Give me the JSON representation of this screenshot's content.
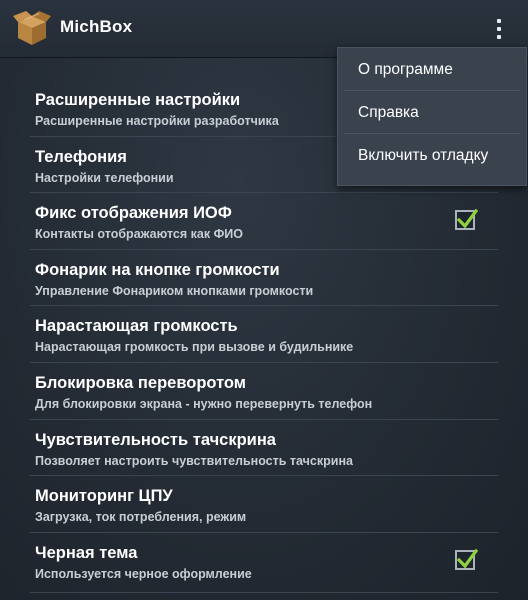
{
  "app": {
    "title": "MichBox",
    "icon": "cardboard-box-icon",
    "overflow_icon": "more-vertical-icon"
  },
  "settings": [
    {
      "title": "Расширенные настройки",
      "summary": "Расширенные настройки разработчика",
      "checkbox": false
    },
    {
      "title": "Телефония",
      "summary": "Настройки телефонии",
      "checkbox": false
    },
    {
      "title": "Фикс отображения ИОФ",
      "summary": "Контакты отображаются как ФИО",
      "checkbox": true,
      "checked": true
    },
    {
      "title": "Фонарик на кнопке громкости",
      "summary": "Управление Фонариком кнопками громкости",
      "checkbox": false
    },
    {
      "title": "Нарастающая громкость",
      "summary": "Нарастающая громкость при вызове и будильнике",
      "checkbox": false
    },
    {
      "title": "Блокировка переворотом",
      "summary": "Для блокировки экрана - нужно перевернуть телефон",
      "checkbox": false
    },
    {
      "title": "Чувствительность тачскрина",
      "summary": "Позволяет настроить чувствительность тачскрина",
      "checkbox": false
    },
    {
      "title": "Мониторинг ЦПУ",
      "summary": "Загрузка, ток потребления, режим",
      "checkbox": false
    },
    {
      "title": "Черная тема",
      "summary": "Используется черное оформление",
      "checkbox": true,
      "checked": true
    }
  ],
  "menu": {
    "items": [
      {
        "label": "О программе"
      },
      {
        "label": "Справка"
      },
      {
        "label": "Включить отладку"
      }
    ]
  },
  "colors": {
    "checkmark": "#8fd140",
    "background": "#242b34",
    "menu_background": "#39424d"
  }
}
